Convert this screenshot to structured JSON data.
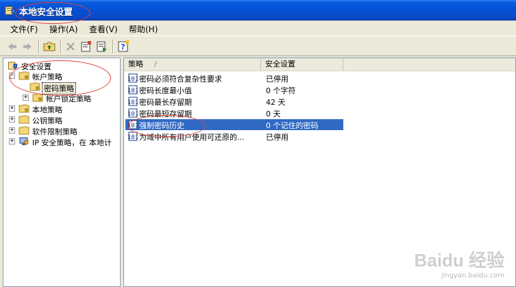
{
  "window": {
    "title": "本地安全设置",
    "icon": "local-security-icon"
  },
  "menu": [
    {
      "label": "文件(F)"
    },
    {
      "label": "操作(A)"
    },
    {
      "label": "查看(V)"
    },
    {
      "label": "帮助(H)"
    }
  ],
  "toolbar": {
    "buttons": [
      "back-icon",
      "forward-icon",
      "up-one-level-icon",
      "delete-icon",
      "properties-icon",
      "export-list-icon",
      "help-icon"
    ]
  },
  "tree": {
    "root": "安全设置",
    "items": [
      {
        "label": "帐户策略"
      },
      {
        "label": "密码策略"
      },
      {
        "label": "帐户锁定策略"
      },
      {
        "label": "本地策略"
      },
      {
        "label": "公钥策略"
      },
      {
        "label": "软件限制策略"
      },
      {
        "label": "IP 安全策略，在 本地计"
      }
    ]
  },
  "list": {
    "columns": [
      "策略",
      "安全设置"
    ],
    "sort_indicator": "/",
    "rows": [
      {
        "policy": "密码必须符合复杂性要求",
        "setting": "已停用"
      },
      {
        "policy": "密码长度最小值",
        "setting": "0 个字符"
      },
      {
        "policy": "密码最长存留期",
        "setting": "42 天"
      },
      {
        "policy": "密码最短存留期",
        "setting": "0 天"
      },
      {
        "policy": "强制密码历史",
        "setting": "0 个记住的密码",
        "selected": true
      },
      {
        "policy": "为域中所有用户使用可还原的...",
        "setting": "已停用"
      }
    ]
  },
  "watermark": {
    "logo": "Baidu 经验",
    "url": "jingyan.baidu.com"
  },
  "colors": {
    "titlebar": "#0550d6",
    "selection": "#316ac5",
    "annotation": "#e0403a"
  }
}
